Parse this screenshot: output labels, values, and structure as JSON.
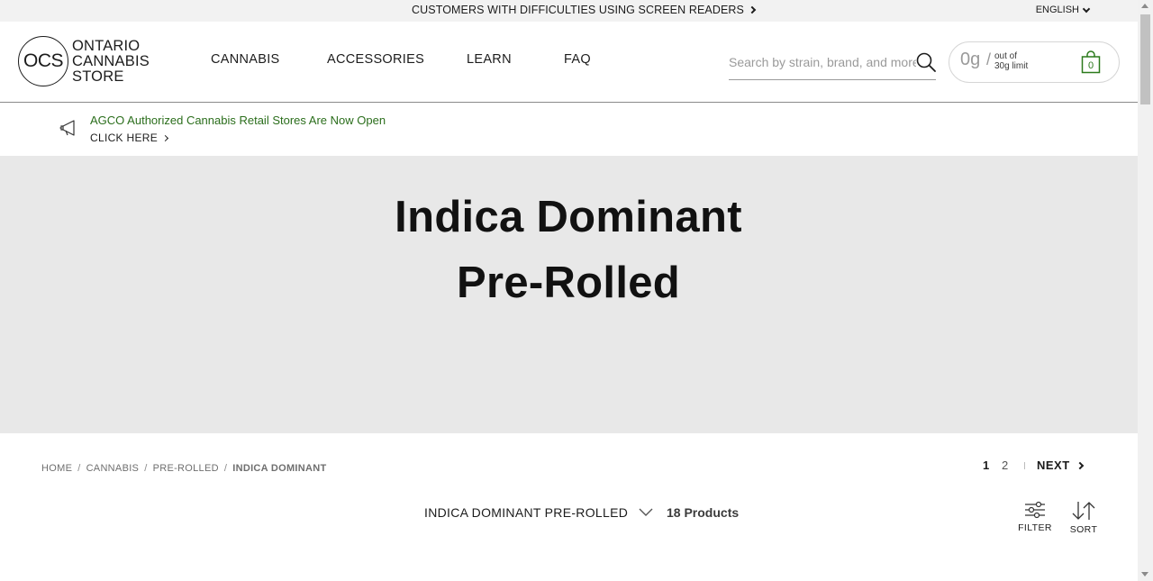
{
  "utility_bar": {
    "accessibility_link": "CUSTOMERS WITH DIFFICULTIES USING SCREEN READERS",
    "language": "ENGLISH"
  },
  "header": {
    "logo": {
      "mark": "OCS",
      "line1": "ONTARIO",
      "line2": "CANNABIS",
      "line3": "STORE"
    },
    "nav": [
      {
        "label": "CANNABIS"
      },
      {
        "label": "ACCESSORIES"
      },
      {
        "label": "LEARN"
      },
      {
        "label": "FAQ"
      }
    ],
    "search": {
      "placeholder": "Search by strain, brand, and more",
      "value": "",
      "icon": "search-icon"
    },
    "cart": {
      "grams": "0g",
      "slash": "/",
      "limit_line1": "out of",
      "limit_line2": "30g limit",
      "count": "0",
      "icon": "shopping-bag-icon",
      "accent_color": "#2b7a1c"
    }
  },
  "announcement": {
    "icon": "megaphone-icon",
    "text": "AGCO Authorized Cannabis Retail Stores Are Now Open",
    "link": "CLICK HERE",
    "text_color": "#2b6e1c"
  },
  "hero": {
    "title": "Indica Dominant Pre-Rolled",
    "background": "#e8e8e8"
  },
  "breadcrumb": [
    {
      "label": "HOME"
    },
    {
      "label": "CANNABIS"
    },
    {
      "label": "PRE-ROLLED"
    },
    {
      "label": "INDICA DOMINANT"
    }
  ],
  "pagination": {
    "current": "1",
    "pages": [
      "1",
      "2"
    ],
    "next": "NEXT"
  },
  "toolbar": {
    "category": "INDICA DOMINANT PRE-ROLLED",
    "product_count": "18 Products",
    "filter_label": "FILTER",
    "sort_label": "SORT"
  }
}
